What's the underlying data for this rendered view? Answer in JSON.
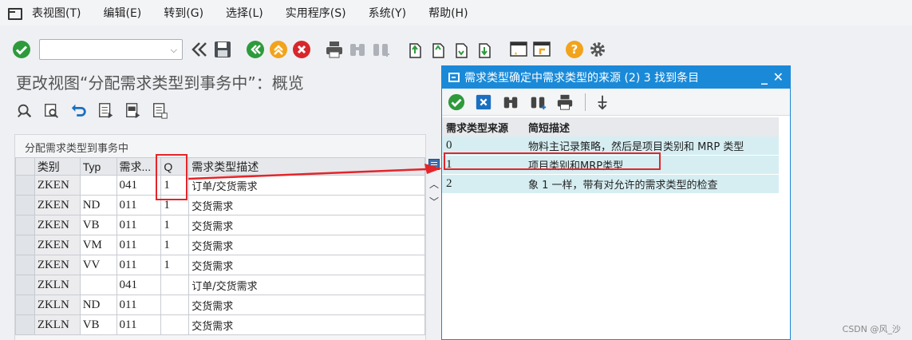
{
  "menubar": {
    "items": [
      "表视图(T)",
      "编辑(E)",
      "转到(G)",
      "选择(L)",
      "实用程序(S)",
      "系统(Y)",
      "帮助(H)"
    ]
  },
  "toolbar": {
    "command_field_value": "",
    "icons": [
      "check-icon",
      "back-icon",
      "save-icon",
      "prev-icon",
      "up-icon",
      "cancel-icon",
      "print-icon",
      "find-icon",
      "find-next-icon",
      "page-first-icon",
      "page-prev-icon",
      "page-next-icon",
      "page-last-icon",
      "new-session-icon",
      "shortcut-icon",
      "help-icon",
      "settings-icon"
    ]
  },
  "page": {
    "title": "更改视图“分配需求类型到事务中”：概览"
  },
  "table": {
    "caption": "分配需求类型到事务中",
    "headers": [
      "类别",
      "Typ",
      "需求...",
      "Q",
      "需求类型描述"
    ],
    "rows": [
      [
        "ZKEN",
        "",
        "041",
        "1",
        "订单/交货需求"
      ],
      [
        "ZKEN",
        "ND",
        "011",
        "1",
        "交货需求"
      ],
      [
        "ZKEN",
        "VB",
        "011",
        "1",
        "交货需求"
      ],
      [
        "ZKEN",
        "VM",
        "011",
        "1",
        "交货需求"
      ],
      [
        "ZKEN",
        "VV",
        "011",
        "1",
        "交货需求"
      ],
      [
        "ZKLN",
        "",
        "041",
        "",
        "订单/交货需求"
      ],
      [
        "ZKLN",
        "ND",
        "011",
        "",
        "交货需求"
      ],
      [
        "ZKLN",
        "VB",
        "011",
        "",
        "交货需求"
      ]
    ]
  },
  "popup": {
    "title": "需求类型确定中需求类型的来源 (2)    3 找到条目",
    "headers": [
      "需求类型来源",
      "简短描述"
    ],
    "rows": [
      [
        "0",
        "物料主记录策略，然后是项目类别和 MRP 类型"
      ],
      [
        "1",
        "项目类别和MRP类型"
      ],
      [
        "2",
        "象 1 一样，带有对允许的需求类型的检查"
      ]
    ]
  },
  "watermark": "CSDN @风_沙",
  "colors": {
    "popup_title_bg": "#1a8ad8",
    "annotation_red": "#e3252a",
    "popup_row_bg": "#d6eef2"
  }
}
